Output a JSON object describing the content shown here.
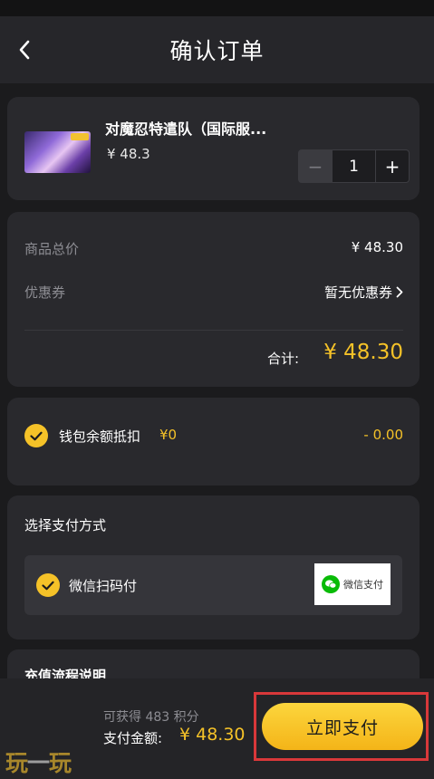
{
  "header": {
    "title": "确认订单",
    "back_icon": "chevron-left-icon"
  },
  "product": {
    "name": "对魔忍特遣队（国际服...",
    "price": "¥ 48.3",
    "quantity": "1",
    "minus_label": "−",
    "plus_label": "+"
  },
  "summary": {
    "subtotal_label": "商品总价",
    "subtotal_value": "¥ 48.30",
    "coupon_label": "优惠券",
    "coupon_value": "暂无优惠券",
    "total_label": "合计:",
    "total_value": "¥ 48.30"
  },
  "wallet": {
    "label": "钱包余额抵扣",
    "balance": "¥0",
    "deduction": "- 0.00",
    "checked": true
  },
  "payment": {
    "title": "选择支付方式",
    "option_label": "微信扫码付",
    "logo_text": "微信支付",
    "checked": true
  },
  "recharge_info": {
    "title": "充值流程说明"
  },
  "footer": {
    "points_text": "可获得 483 积分",
    "amount_label": "支付金额:",
    "amount_value": "¥ 48.30",
    "pay_button": "立即支付",
    "watermark_a": "玩",
    "watermark_b": "一",
    "watermark_c": "玩"
  },
  "colors": {
    "accent": "#f5c228",
    "background": "#1b1b1d",
    "card": "#29292d",
    "highlight_frame": "#d9383a"
  }
}
